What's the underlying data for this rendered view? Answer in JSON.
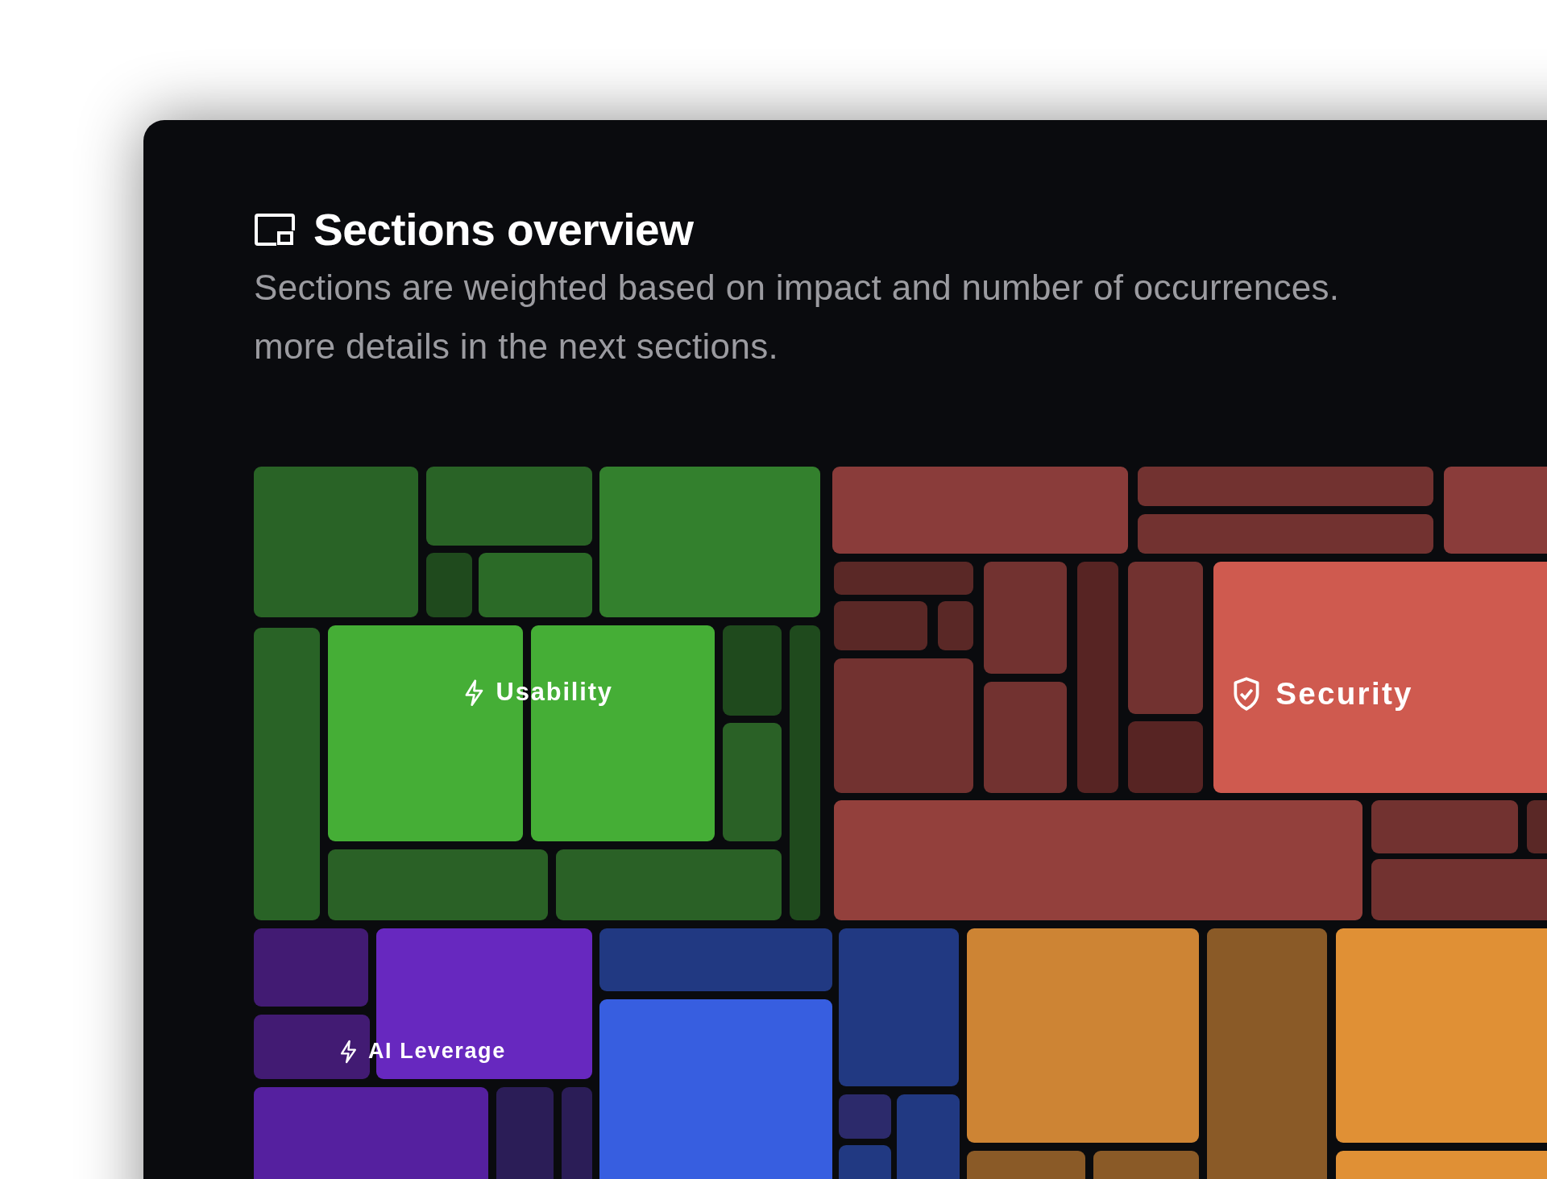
{
  "panel": {
    "title": "Sections overview",
    "description_lines": [
      "Sections are weighted based on impact and number of occurrences.",
      "more details in the next sections."
    ]
  },
  "treemap": {
    "sections": [
      {
        "label": "Usability",
        "kind": "bolt"
      },
      {
        "label": "Security",
        "kind": "shield"
      },
      {
        "label": "AI Leverage",
        "kind": "bolt"
      }
    ],
    "tiles": [
      {
        "color": "#296326"
      },
      {
        "color": "#296326"
      },
      {
        "color": "#1f4a1d"
      },
      {
        "color": "#2b6a27"
      },
      {
        "color": "#33802d"
      },
      {
        "color": "#296326"
      },
      {
        "color": "#45ae36"
      },
      {
        "color": "#45ae36"
      },
      {
        "color": "#1f4a1d"
      },
      {
        "color": "#2a6126"
      },
      {
        "color": "#1f4a1d"
      },
      {
        "color": "#2a6126"
      },
      {
        "color": "#2a6126"
      },
      {
        "color": "#8a3c3a"
      },
      {
        "color": "#723230"
      },
      {
        "color": "#723230"
      },
      {
        "color": "#8a3c3a"
      },
      {
        "color": "#5a2826"
      },
      {
        "color": "#5a2826"
      },
      {
        "color": "#5a2826"
      },
      {
        "color": "#723230"
      },
      {
        "color": "#723230"
      },
      {
        "color": "#723230"
      },
      {
        "color": "#572423"
      },
      {
        "color": "#723230"
      },
      {
        "color": "#572423"
      },
      {
        "color": "#cf5a4f"
      },
      {
        "color": "#93403c"
      },
      {
        "color": "#723230"
      },
      {
        "color": "#5a2826"
      },
      {
        "color": "#723230"
      },
      {
        "color": "#421b73"
      },
      {
        "color": "#6728bf"
      },
      {
        "color": "#421b73"
      },
      {
        "color": "#55209f"
      },
      {
        "color": "#2b1d57"
      },
      {
        "color": "#2b1d57"
      },
      {
        "color": "#213982"
      },
      {
        "color": "#375ee0"
      },
      {
        "color": "#213982"
      },
      {
        "color": "#2c2a6b"
      },
      {
        "color": "#213982"
      },
      {
        "color": "#213982"
      },
      {
        "color": "#cd8434"
      },
      {
        "color": "#8a5a27"
      },
      {
        "color": "#e09035"
      },
      {
        "color": "#8a5a27"
      },
      {
        "color": "#8a5a27"
      },
      {
        "color": "#e09035"
      }
    ]
  }
}
